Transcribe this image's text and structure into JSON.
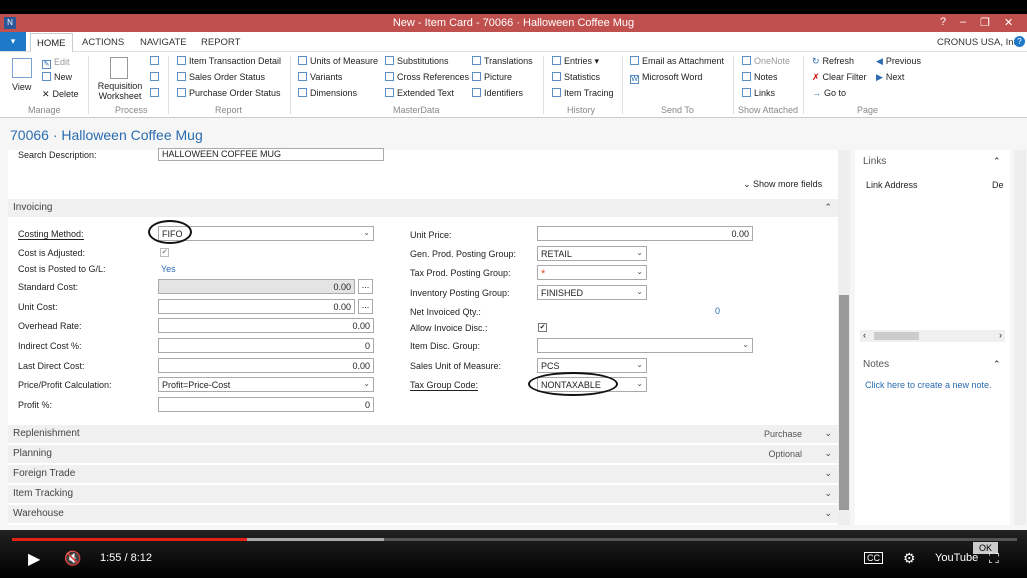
{
  "window": {
    "title": "New - Item Card - 70066 · Halloween Coffee Mug"
  },
  "ribbon_tabs": {
    "home": "HOME",
    "actions": "ACTIONS",
    "navigate": "NAVIGATE",
    "report": "REPORT",
    "company": "CRONUS USA, Inc."
  },
  "ribbon": {
    "manage": {
      "view": "View",
      "edit": "Edit",
      "new": "New",
      "delete": "Delete",
      "group": "Manage"
    },
    "process": {
      "worksheet": "Requisition Worksheet",
      "group": "Process"
    },
    "report": {
      "item_trans": "Item Transaction Detail",
      "sales_status": "Sales Order Status",
      "po_status": "Purchase Order Status",
      "group": "Report"
    },
    "masterdata": {
      "uom": "Units of Measure",
      "variants": "Variants",
      "dimensions": "Dimensions",
      "substitutions": "Substitutions",
      "cross_ref": "Cross References",
      "ext_text": "Extended Text",
      "translations": "Translations",
      "picture": "Picture",
      "identifiers": "Identifiers",
      "group": "MasterData"
    },
    "history": {
      "entries": "Entries",
      "statistics": "Statistics",
      "tracing": "Item Tracing",
      "group": "History"
    },
    "sendto": {
      "email": "Email as Attachment",
      "word": "Microsoft Word",
      "group": "Send To"
    },
    "attached": {
      "onenote": "OneNote",
      "notes": "Notes",
      "links": "Links",
      "group": "Show Attached"
    },
    "page": {
      "refresh": "Refresh",
      "clear_filter": "Clear Filter",
      "goto": "Go to",
      "previous": "Previous",
      "next": "Next",
      "group": "Page"
    }
  },
  "page_title": "70066 · Halloween Coffee Mug",
  "general": {
    "search_label": "Search Description:",
    "search_value": "HALLOWEEN COFFEE MUG",
    "show_more": "Show more fields"
  },
  "invoicing": {
    "header": "Invoicing",
    "costing_method_label": "Costing Method:",
    "costing_method": "FIFO",
    "cost_adjusted_label": "Cost is Adjusted:",
    "posted_gl_label": "Cost is Posted to G/L:",
    "posted_gl": "Yes",
    "standard_cost_label": "Standard Cost:",
    "standard_cost": "0.00",
    "unit_cost_label": "Unit Cost:",
    "unit_cost": "0.00",
    "overhead_label": "Overhead Rate:",
    "overhead": "0.00",
    "indirect_label": "Indirect Cost %:",
    "indirect": "0",
    "last_direct_label": "Last Direct Cost:",
    "last_direct": "0.00",
    "price_calc_label": "Price/Profit Calculation:",
    "price_calc": "Profit=Price-Cost",
    "profit_label": "Profit %:",
    "profit": "0",
    "unit_price_label": "Unit Price:",
    "unit_price": "0.00",
    "gen_prod_label": "Gen. Prod. Posting Group:",
    "gen_prod": "RETAIL",
    "tax_prod_label": "Tax Prod. Posting Group:",
    "tax_prod": "*",
    "inv_post_label": "Inventory Posting Group:",
    "inv_post": "FINISHED",
    "net_inv_label": "Net Invoiced Qty.:",
    "net_inv": "0",
    "allow_disc_label": "Allow Invoice Disc.:",
    "item_disc_label": "Item Disc. Group:",
    "sales_uom_label": "Sales Unit of Measure:",
    "sales_uom": "PCS",
    "tax_group_label": "Tax Group Code:",
    "tax_group": "NONTAXABLE"
  },
  "sections": {
    "replenishment": "Replenishment",
    "replenishment_val": "Purchase",
    "planning": "Planning",
    "planning_val": "Optional",
    "foreign": "Foreign Trade",
    "tracking": "Item Tracking",
    "warehouse": "Warehouse"
  },
  "factbox": {
    "links": "Links",
    "link_address": "Link Address",
    "de": "De",
    "notes": "Notes",
    "create_note": "Click here to create a new note."
  },
  "player": {
    "time": "1:55 / 8:12",
    "progress": 0.234,
    "buffered": 0.37,
    "ok": "OK"
  }
}
